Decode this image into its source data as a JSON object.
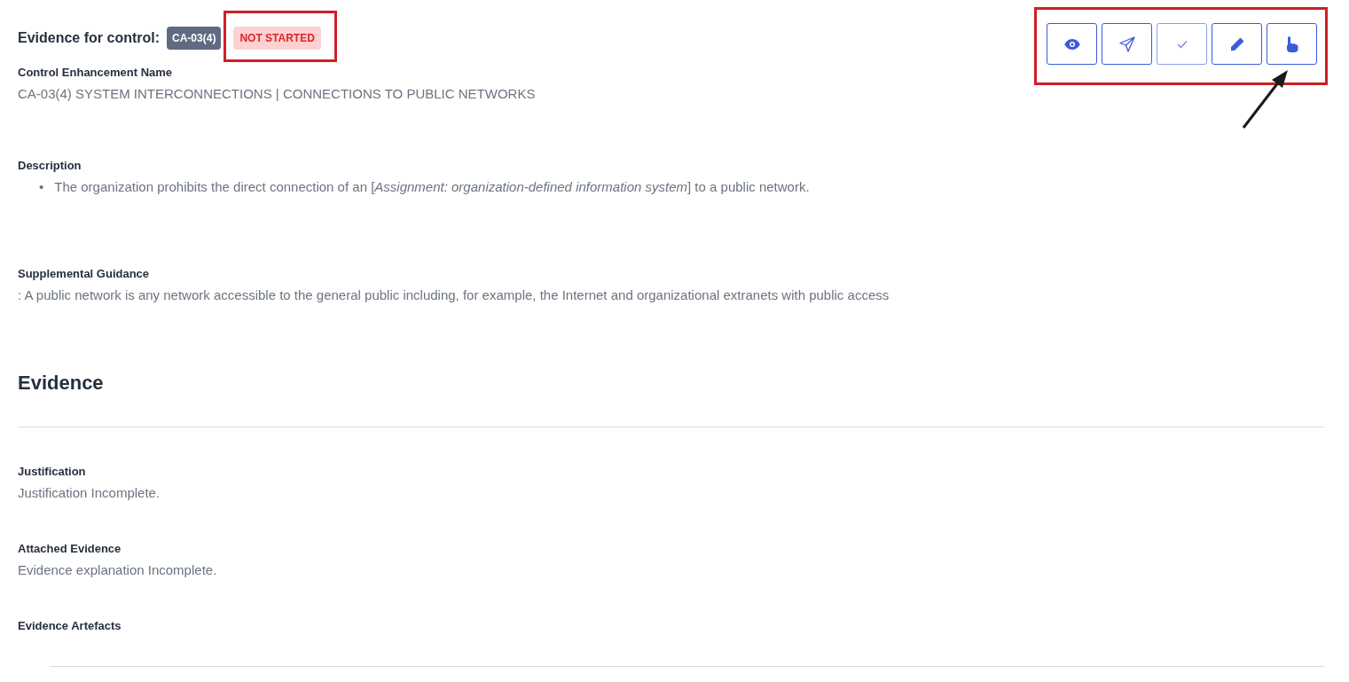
{
  "header": {
    "title": "Evidence for control:",
    "control_id": "CA-03(4)",
    "status": "NOT STARTED"
  },
  "actions": [
    {
      "kind": "view",
      "disabled": false
    },
    {
      "kind": "send",
      "disabled": false
    },
    {
      "kind": "approve",
      "disabled": true
    },
    {
      "kind": "edit",
      "disabled": false
    },
    {
      "kind": "claim",
      "disabled": false
    }
  ],
  "control_enhancement": {
    "label": "Control Enhancement Name",
    "value": "CA-03(4) SYSTEM INTERCONNECTIONS | CONNECTIONS TO PUBLIC NETWORKS"
  },
  "description": {
    "label": "Description",
    "marker": "•",
    "items": [
      "The organization prohibits the direct connection of an [*Assignment: organization-defined information system*] to a public network."
    ]
  },
  "supplemental_guidance": {
    "label": "Supplemental Guidance",
    "value": ": A public network is any network accessible to the general public including, for example, the Internet and organizational extranets with public access"
  },
  "evidence": {
    "heading": "Evidence",
    "fields": [
      {
        "label": "Justification",
        "value": "Justification Incomplete."
      },
      {
        "label": "Attached Evidence",
        "value": "Evidence explanation Incomplete."
      }
    ],
    "artefacts_label": "Evidence Artefacts"
  }
}
